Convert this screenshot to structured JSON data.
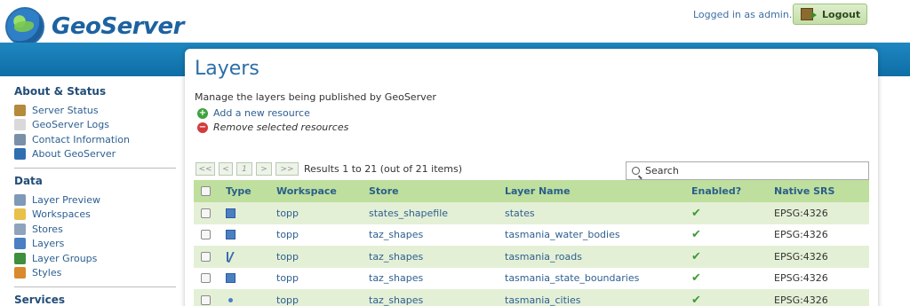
{
  "header": {
    "brand": "GeoServer",
    "logged_in_text": "Logged in as admin.",
    "logout_label": "Logout"
  },
  "sidebar": {
    "sections": [
      {
        "title": "About & Status",
        "items": [
          {
            "label": "Server Status",
            "icon": "server-status-icon",
            "color": "#b58a3a"
          },
          {
            "label": "GeoServer Logs",
            "icon": "logs-icon",
            "color": "#d9d9d9"
          },
          {
            "label": "Contact Information",
            "icon": "contact-icon",
            "color": "#7a8fa8"
          },
          {
            "label": "About GeoServer",
            "icon": "about-icon",
            "color": "#2f6fb0"
          }
        ]
      },
      {
        "title": "Data",
        "items": [
          {
            "label": "Layer Preview",
            "icon": "layer-preview-icon",
            "color": "#7f9ab8"
          },
          {
            "label": "Workspaces",
            "icon": "workspaces-icon",
            "color": "#e9c04a"
          },
          {
            "label": "Stores",
            "icon": "stores-icon",
            "color": "#8fa3bd"
          },
          {
            "label": "Layers",
            "icon": "layers-icon",
            "color": "#4a7fc3"
          },
          {
            "label": "Layer Groups",
            "icon": "layer-groups-icon",
            "color": "#3e8f3e"
          },
          {
            "label": "Styles",
            "icon": "styles-icon",
            "color": "#d88a2c"
          }
        ]
      },
      {
        "title": "Services",
        "items": []
      }
    ]
  },
  "main": {
    "title": "Layers",
    "description": "Manage the layers being published by GeoServer",
    "add_label": "Add a new resource",
    "remove_label": "Remove selected resources",
    "pager": {
      "first": "<<",
      "prev": "<",
      "current": "1",
      "next": ">",
      "last": ">>",
      "result_text": "Results 1 to 21 (out of 21 items)"
    },
    "search_placeholder": "Search",
    "columns": [
      "Type",
      "Workspace",
      "Store",
      "Layer Name",
      "Enabled?",
      "Native SRS"
    ],
    "rows": [
      {
        "type": "polygon",
        "workspace": "topp",
        "store": "states_shapefile",
        "layer": "states",
        "enabled": "✔",
        "srs": "EPSG:4326"
      },
      {
        "type": "polygon",
        "workspace": "topp",
        "store": "taz_shapes",
        "layer": "tasmania_water_bodies",
        "enabled": "✔",
        "srs": "EPSG:4326"
      },
      {
        "type": "line",
        "workspace": "topp",
        "store": "taz_shapes",
        "layer": "tasmania_roads",
        "enabled": "✔",
        "srs": "EPSG:4326"
      },
      {
        "type": "polygon",
        "workspace": "topp",
        "store": "taz_shapes",
        "layer": "tasmania_state_boundaries",
        "enabled": "✔",
        "srs": "EPSG:4326"
      },
      {
        "type": "point",
        "workspace": "topp",
        "store": "taz_shapes",
        "layer": "tasmania_cities",
        "enabled": "✔",
        "srs": "EPSG:4326"
      }
    ]
  }
}
